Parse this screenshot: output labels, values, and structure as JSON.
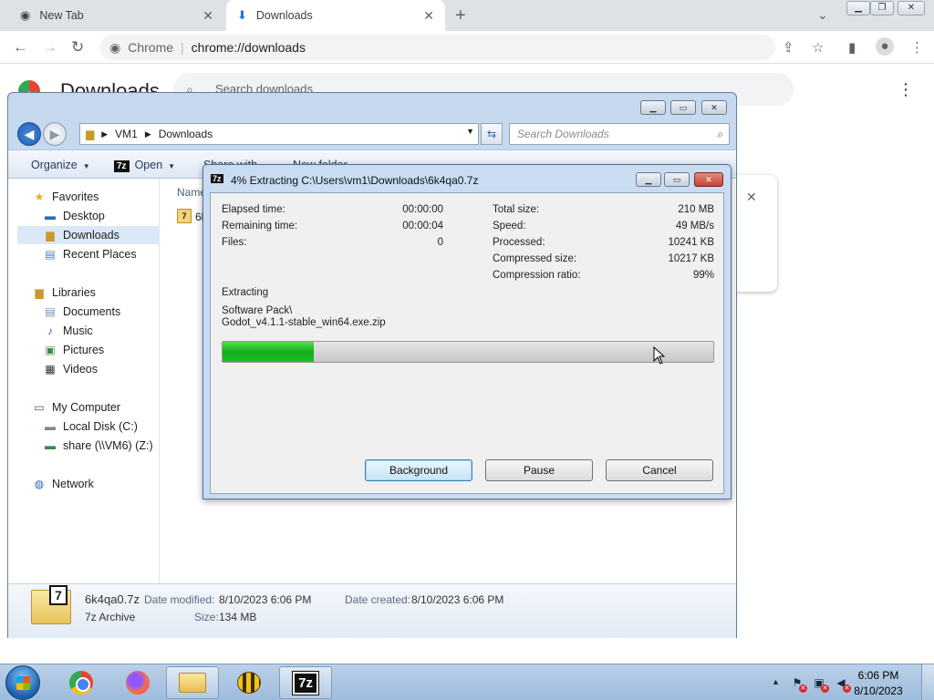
{
  "chrome": {
    "tabs": [
      {
        "label": "New Tab"
      },
      {
        "label": "Downloads"
      }
    ],
    "omnibox": {
      "site": "Chrome",
      "url": "chrome://downloads"
    },
    "page": {
      "title": "Downloads",
      "search_placeholder": "Search downloads"
    }
  },
  "explorer": {
    "breadcrumb": [
      "VM1",
      "Downloads"
    ],
    "search_placeholder": "Search Downloads",
    "commands": {
      "organize": "Organize",
      "open": "Open",
      "share": "Share with",
      "new_folder": "New folder"
    },
    "nav": {
      "favorites": "Favorites",
      "desktop": "Desktop",
      "downloads": "Downloads",
      "recent": "Recent Places",
      "libraries": "Libraries",
      "documents": "Documents",
      "music": "Music",
      "pictures": "Pictures",
      "videos": "Videos",
      "computer": "My Computer",
      "local_disk": "Local Disk (C:)",
      "share": "share (\\\\VM6) (Z:)",
      "network": "Network"
    },
    "file_list": {
      "column_name": "Name",
      "file_partial": "6k"
    },
    "details": {
      "filename": "6k4qa0.7z",
      "type": "7z Archive",
      "modified_label": "Date modified:",
      "modified_value": "8/10/2023 6:06 PM",
      "created_label": "Date created:",
      "created_value": "8/10/2023 6:06 PM",
      "size_label": "Size:",
      "size_value": "134 MB"
    }
  },
  "zip_dialog": {
    "title": "4% Extracting C:\\Users\\vm1\\Downloads\\6k4qa0.7z",
    "elapsed_label": "Elapsed time:",
    "elapsed_value": "00:00:00",
    "remaining_label": "Remaining time:",
    "remaining_value": "00:00:04",
    "files_label": "Files:",
    "files_value": "0",
    "total_label": "Total size:",
    "total_value": "210 MB",
    "speed_label": "Speed:",
    "speed_value": "49 MB/s",
    "processed_label": "Processed:",
    "processed_value": "10241 KB",
    "compressed_label": "Compressed size:",
    "compressed_value": "10217 KB",
    "ratio_label": "Compression ratio:",
    "ratio_value": "99%",
    "status_label": "Extracting",
    "path_line1": "Software Pack\\",
    "path_line2": "Godot_v4.1.1-stable_win64.exe.zip",
    "progress": 0.185,
    "buttons": {
      "background": "Background",
      "pause": "Pause",
      "cancel": "Cancel"
    }
  },
  "taskbar": {
    "clock_time": "6:06 PM",
    "clock_date": "8/10/2023",
    "apps": [
      "chrome-icon",
      "firefox-icon",
      "file-explorer-icon",
      "bee-icon",
      "7zip-icon"
    ]
  }
}
